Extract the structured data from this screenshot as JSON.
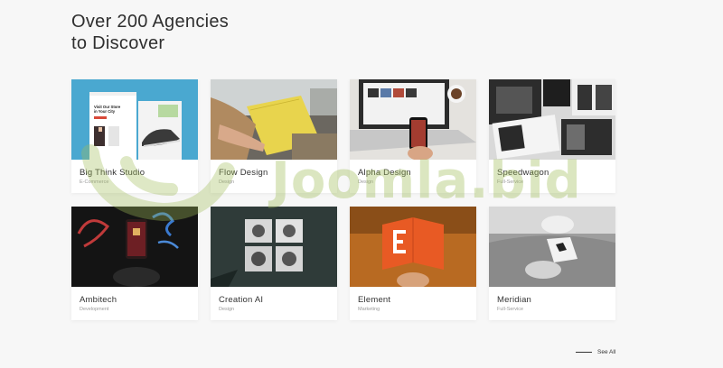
{
  "header": {
    "title_line1": "Over 200 Agencies",
    "title_line2": "to Discover"
  },
  "agencies": [
    {
      "name": "Big Think Studio",
      "category": "E-Commerce",
      "image": "ecommerce-mockup"
    },
    {
      "name": "Flow Design",
      "category": "Design",
      "image": "yellow-notebook"
    },
    {
      "name": "Alpha Design",
      "category": "Design",
      "image": "laptop-phone"
    },
    {
      "name": "Speedwagon",
      "category": "Full-Service",
      "image": "print-magazine"
    },
    {
      "name": "Ambitech",
      "category": "Development",
      "image": "neon-phone"
    },
    {
      "name": "Creation AI",
      "category": "Design",
      "image": "faces-posters"
    },
    {
      "name": "Element",
      "category": "Marketing",
      "image": "orange-book"
    },
    {
      "name": "Meridian",
      "category": "Full-Service",
      "image": "grey-couch"
    }
  ],
  "thumb_mockup": {
    "headline_line1": "Visit Our Store",
    "headline_line2": "in Your City"
  },
  "see_all": {
    "label": "See All"
  },
  "watermark": {
    "text": "Joomla.bid"
  },
  "colors": {
    "background": "#f7f7f7",
    "card": "#ffffff",
    "watermark": "#a0be5a"
  }
}
